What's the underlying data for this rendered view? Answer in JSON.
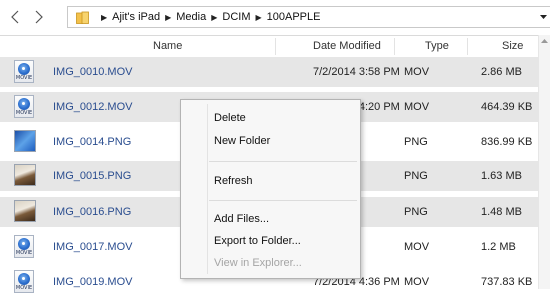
{
  "breadcrumb": [
    "Ajit's iPad",
    "Media",
    "DCIM",
    "100APPLE"
  ],
  "columns": {
    "name": "Name",
    "date": "Date Modified",
    "type": "Type",
    "size": "Size"
  },
  "rows": [
    {
      "name": "IMG_0010.MOV",
      "date": "7/2/2014 3:58 PM",
      "type": "MOV",
      "size": "2.86 MB",
      "kind": "mov",
      "selected": true
    },
    {
      "name": "IMG_0012.MOV",
      "date": "7/2/2014 4:20 PM",
      "type": "MOV",
      "size": "464.39 KB",
      "kind": "mov",
      "selected": true
    },
    {
      "name": "IMG_0014.PNG",
      "date": "PM",
      "type": "PNG",
      "size": "836.99 KB",
      "kind": "png-blue",
      "selected": false
    },
    {
      "name": "IMG_0015.PNG",
      "date": "PM",
      "type": "PNG",
      "size": "1.63 MB",
      "kind": "png-room",
      "selected": true
    },
    {
      "name": "IMG_0016.PNG",
      "date": "PM",
      "type": "PNG",
      "size": "1.48 MB",
      "kind": "png-room",
      "selected": true
    },
    {
      "name": "IMG_0017.MOV",
      "date": "PM",
      "type": "MOV",
      "size": "1.2 MB",
      "kind": "mov",
      "selected": false
    },
    {
      "name": "IMG_0019.MOV",
      "date": "7/2/2014 4:36 PM",
      "type": "MOV",
      "size": "737.83 KB",
      "kind": "mov",
      "selected": false
    }
  ],
  "icon_label": "MOVIE",
  "context_menu": {
    "delete": "Delete",
    "new_folder": "New Folder",
    "refresh": "Refresh",
    "add_files": "Add Files...",
    "export": "Export to Folder...",
    "view_explorer": "View in Explorer..."
  }
}
